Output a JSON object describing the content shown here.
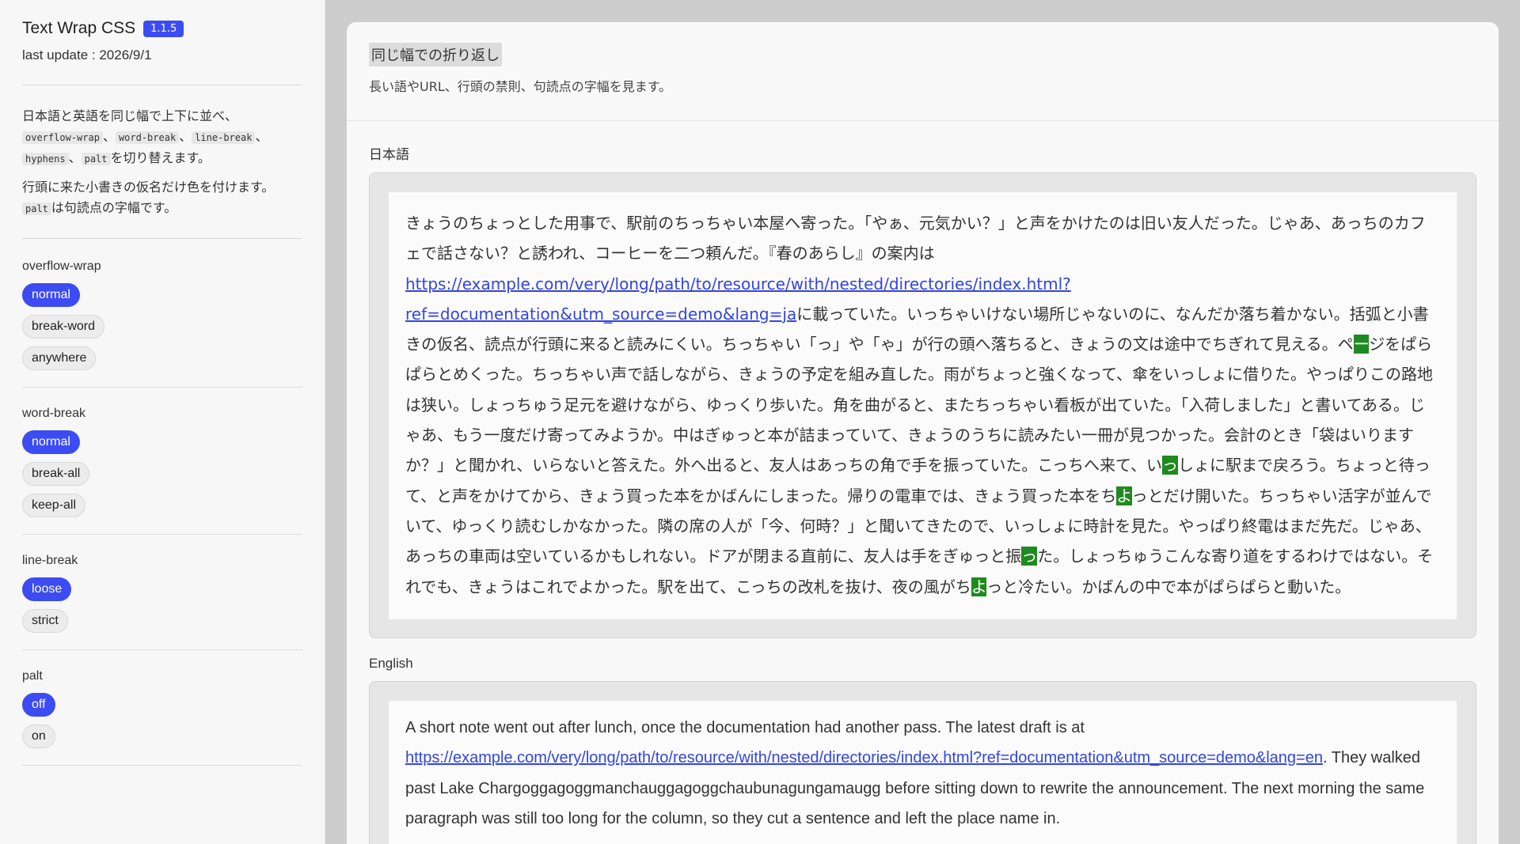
{
  "sidebar": {
    "title": "Text Wrap CSS",
    "version": "1.1.5",
    "last_update": "last update : 2026/9/1",
    "desc1_pre": "日本語と英語を同じ幅で上下に並べ、",
    "code_overflow_wrap": "overflow-wrap",
    "sep1": "、",
    "code_word_break": "word-break",
    "sep2": "、",
    "code_line_break": "line-break",
    "sep3": "、",
    "code_hyphens": "hyphens",
    "sep4": "、",
    "code_palt": "palt",
    "desc1_post": "を切り替えます。",
    "desc2": "行頭に来た小書きの仮名だけ色を付けます。",
    "code_palt2": "palt",
    "desc3": "は句読点の字幅です。",
    "groups": [
      {
        "label": "overflow-wrap",
        "options": [
          "normal",
          "break-word",
          "anywhere"
        ],
        "selected": "normal"
      },
      {
        "label": "word-break",
        "options": [
          "normal",
          "break-all",
          "keep-all"
        ],
        "selected": "normal"
      },
      {
        "label": "line-break",
        "options": [
          "loose",
          "strict"
        ],
        "selected": "loose"
      },
      {
        "label": "palt",
        "options": [
          "off",
          "on"
        ],
        "selected": "off"
      }
    ]
  },
  "main": {
    "section_title": "同じ幅での折り返し",
    "section_sub": "長い語やURL、行頭の禁則、句読点の字幅を見ます。",
    "ja_label": "日本語",
    "en_label": "English",
    "ja": {
      "p1": "きょうのちょっとした用事で、駅前のちっちゃい本屋へ寄った。「やぁ、元気かい？」と声をかけたのは旧い友人だった。じゃあ、あっちのカフェで話さない？と誘われ、コーヒーを二つ頼んだ。『春のあらし』の案内は",
      "link1": "https://example.com/very/long/path/to/resource/with/nested/directories/index.html?",
      "link2": "ref=documentation&utm_source=demo&lang=ja",
      "p2": "に載っていた。いっちゃいけない場所じゃないのに、なんだか落ち着かない。括弧と小書きの仮名、読点が行頭に来ると読みにくい。ちっちゃい「っ」や「ゃ」が行の頭へ落ちると、きょうの文は途中でちぎれて見える。ペ",
      "k1": "ー",
      "p3": "ジをぱらぱらとめくった。ちっちゃい声で話しながら、きょうの予定を組み直した。雨がちょっと強くなって、傘をいっしょに借りた。やっぱりこの路地は狭い。しょっちゅう足元を避けながら、ゆっくり歩いた。角を曲がると、またちっちゃい看板が出ていた。「入荷しました」と書いてある。じゃあ、もう一度だけ寄ってみようか。中はぎゅっと本が詰まっていて、きょうのうちに読みたい一冊が見つかった。会計のとき「袋はいりますか？」と聞かれ、いらないと答えた。外へ出ると、友人はあっちの角で手を振っていた。こっちへ来て、い",
      "k2": "っ",
      "p4": "しょに駅まで戻ろう。ちょっと待って、と声をかけてから、きょう買った本をかばんにしまった。帰りの電車では、きょう買った本をち",
      "k3": "よ",
      "p5": "っとだけ開いた。ちっちゃい活字が並んでいて、ゆっくり読むしかなかった。隣の席の人が「今、何時？」と聞いてきたので、いっしょに時計を見た。やっぱり終電はまだ先だ。じゃあ、あっちの車両は空いているかもしれない。ドアが閉まる直前に、友人は手をぎゅっと振",
      "k4": "っ",
      "p6": "た。しょっちゅうこんな寄り道をするわけではない。それでも、きょうはこれでよかった。駅を出て、こっちの改札を抜け、夜の風がち",
      "k5": "よ",
      "p7": "っと冷たい。かばんの中で本がぱらぱらと動いた。"
    },
    "en": {
      "p1": "A short note went out after lunch, once the documentation had another pass. The latest draft is at",
      "link": "https://example.com/very/long/path/to/resource/with/nested/directories/index.html?ref=documentation&utm_source=demo&lang=en",
      "p2": ". They walked past Lake Chargoggagoggmanchauggagoggchaubunagungamaugg before sitting down to rewrite the announcement. The next morning the same paragraph was still too long for the column, so they cut a sentence and left the place name in."
    }
  }
}
